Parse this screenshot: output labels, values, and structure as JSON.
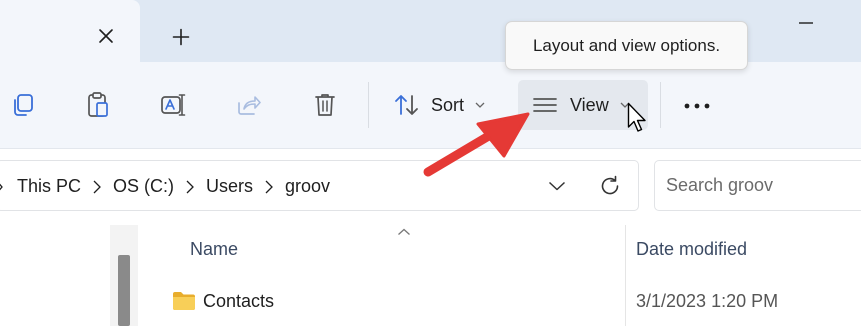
{
  "tabs": {
    "close_icon": "close-icon",
    "new_tab_icon": "plus-icon"
  },
  "window": {
    "minimize_icon": "minimize-icon"
  },
  "toolbar": {
    "icons": [
      "copy-icon",
      "paste-icon",
      "rename-icon",
      "share-icon",
      "delete-icon"
    ],
    "sort_label": "Sort",
    "view_label": "View",
    "more_icon": "more-options-icon"
  },
  "tooltip": {
    "text": "Layout and view options."
  },
  "address_bar": {
    "breadcrumbs": [
      "This PC",
      "OS (C:)",
      "Users",
      "groov"
    ]
  },
  "search": {
    "placeholder": "Search groov"
  },
  "file_list": {
    "columns": {
      "name": "Name",
      "date_modified": "Date modified"
    },
    "rows": [
      {
        "name": "Contacts",
        "date_modified": "3/1/2023 1:20 PM",
        "icon": "folder-icon"
      }
    ]
  },
  "colors": {
    "titlebar_bg": "#dfe8f3",
    "commandbar_bg": "#f3f6fb",
    "annotation_arrow": "#e53935",
    "folder": "#f4c542"
  }
}
